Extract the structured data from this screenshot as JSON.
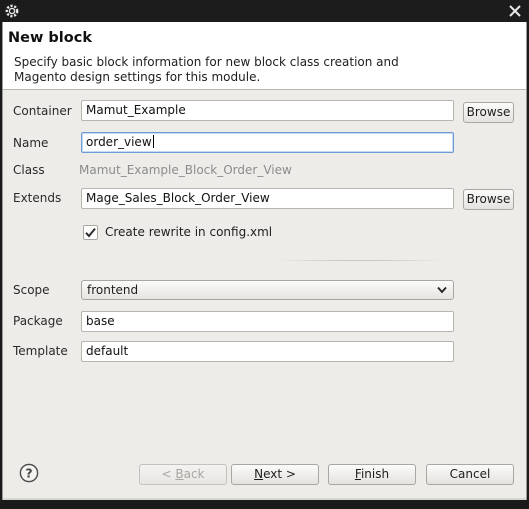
{
  "window": {
    "close_icon": "close-icon",
    "app_icon": "gear-icon"
  },
  "header": {
    "title": "New block",
    "description": "Specify basic block information for new block class creation and Magento design settings for this module."
  },
  "form": {
    "container_label": "Container",
    "container_value": "Mamut_Example",
    "name_label": "Name",
    "name_value": "order_view",
    "class_label": "Class",
    "class_value": "Mamut_Example_Block_Order_View",
    "extends_label": "Extends",
    "extends_value": "Mage_Sales_Block_Order_View",
    "browse_label": "Browse",
    "rewrite_label": "Create rewrite in config.xml",
    "rewrite_checked": true,
    "scope_label": "Scope",
    "scope_value": "frontend",
    "package_label": "Package",
    "package_value": "base",
    "template_label": "Template",
    "template_value": "default"
  },
  "buttons": {
    "back": {
      "prefix": "< ",
      "mnemonic": "B",
      "rest": "ack"
    },
    "next": {
      "mnemonic": "N",
      "rest": "ext >"
    },
    "finish": {
      "mnemonic": "F",
      "rest": "inish"
    },
    "cancel": "Cancel"
  },
  "colors": {
    "field_focus_border": "#6e9bd3",
    "dialog_bg": "#edece9",
    "readonly_text": "#8c8c8c"
  }
}
